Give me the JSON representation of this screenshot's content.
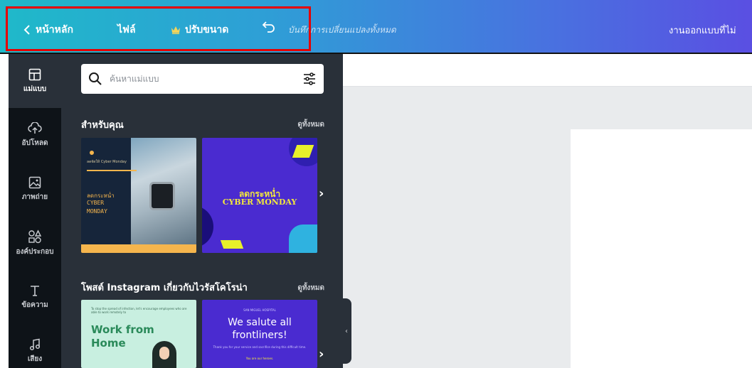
{
  "topbar": {
    "home_label": "หน้าหลัก",
    "file_label": "ไฟล์",
    "resize_label": "ปรับขนาด",
    "saved_note": "บันทึกการเปลี่ยนแปลงทั้งหมด",
    "design_title": "งานออกแบบที่ไม่"
  },
  "rail": {
    "items": [
      {
        "label": "แม่แบบ",
        "icon": "template-icon"
      },
      {
        "label": "อัปโหลด",
        "icon": "upload-icon"
      },
      {
        "label": "ภาพถ่าย",
        "icon": "photo-icon"
      },
      {
        "label": "องค์ประกอบ",
        "icon": "elements-icon"
      },
      {
        "label": "ข้อความ",
        "icon": "text-icon"
      },
      {
        "label": "เสียง",
        "icon": "music-icon"
      }
    ]
  },
  "panel": {
    "search_placeholder": "ค้นหาแม่แบบ",
    "sections": [
      {
        "title": "สำหรับคุณ",
        "see_all": "ดูทั้งหมด",
        "templates": [
          {
            "small": "ลดจัดให้ Cyber Monday",
            "lines": [
              "ลดกระหน่ำ",
              "CYBER",
              "MONDAY"
            ]
          },
          {
            "line1": "ลดกระหน่ำ",
            "line2": "CYBER MONDAY"
          }
        ]
      },
      {
        "title": "โพสต์ Instagram เกี่ยวกับไวรัสโคโรน่า",
        "see_all": "ดูทั้งหมด",
        "templates": [
          {
            "small": "To stop the spread of infection, let's encourage employees who are able to work remotely to",
            "line1": "Work from",
            "line2": "Home"
          },
          {
            "small1": "SAN MIGUEL HOSPITAL",
            "line1": "We salute all",
            "line2": "frontliners!",
            "small2": "Thank you for your service and sacrifice during this difficult time.",
            "small3": "You are our heroes."
          }
        ]
      }
    ]
  },
  "colors": {
    "topbar_start": "#1fb9c9",
    "topbar_end": "#5a4fe2",
    "highlight": "#e60000",
    "rail_bg": "#0e1318",
    "panel_bg": "#293039"
  }
}
